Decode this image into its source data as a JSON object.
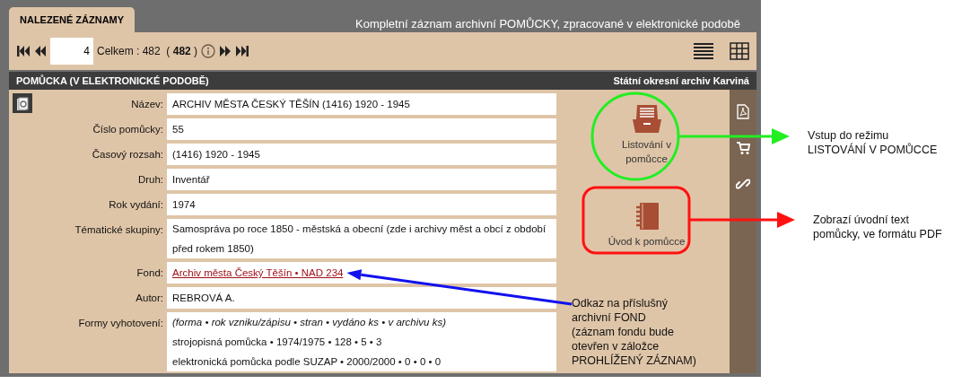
{
  "tab": {
    "label": "NALEZENÉ ZÁZNAMY",
    "selected": true
  },
  "heading": "Kompletní záznam archivní POMŮCKY, zpracované v elektronické podobě",
  "pager": {
    "page": "4",
    "total": "Celkem : 482  ( **482** )"
  },
  "section": {
    "title": "POMŮCKA (V ELEKTRONICKÉ PODOBĚ)",
    "archive": "Státní okresní archiv Karviná"
  },
  "fields": [
    {
      "label": "Název:",
      "kind": "text",
      "lines": [
        "ARCHIV MĚSTA ČESKÝ TĚŠÍN (1416) 1920 - 1945"
      ]
    },
    {
      "label": "Číslo pomůcky:",
      "kind": "text",
      "lines": [
        "55"
      ]
    },
    {
      "label": "Časový rozsah:",
      "kind": "text",
      "lines": [
        "(1416) 1920 - 1945"
      ]
    },
    {
      "label": "Druh:",
      "kind": "text",
      "lines": [
        "Inventář"
      ]
    },
    {
      "label": "Rok vydání:",
      "kind": "text",
      "lines": [
        "1974"
      ]
    },
    {
      "label": "Tématické skupiny:",
      "kind": "text",
      "lines": [
        "Samospráva po roce 1850 - městská a obecní (zde i archivy měst a obcí z období před rokem 1850)"
      ]
    },
    {
      "label": "Fond:",
      "kind": "link",
      "lines": [
        "Archiv města Český Těšín • NAD 234"
      ]
    },
    {
      "label": "Autor:",
      "kind": "text",
      "lines": [
        "REBROVÁ A."
      ]
    },
    {
      "label": "Formy vyhotovení:",
      "kind": "list",
      "legend": "(forma • rok vzniku/zápisu • stran • vydáno ks • v archivu ks)",
      "lines": [
        "strojopisná pomůcka • 1974/1975 • 128 • 5 • 3",
        "elektronická pomůcka podle SUZAP • 2000/2000 • 0 • 0 • 0"
      ]
    }
  ],
  "actions": [
    {
      "label": "Listování v pomůcce",
      "kind": "drawer"
    },
    {
      "label": "Úvod k pomůcce",
      "kind": "notebook"
    }
  ],
  "annotations": [
    {
      "text": "Vstup do režimu\nLISTOVÁNÍ V POMŮCCE",
      "color": "#22ee22"
    },
    {
      "text": "Zobrazí úvodní text\npomůcky, ve formátu PDF",
      "color": "#ff1111"
    },
    {
      "text": "Odkaz na příslušný\narchivní FOND\n(záznam fondu bude\notevřen v záložce\nPROHLÍŽENÝ ZÁZNAM)",
      "color": "#1111ee"
    }
  ]
}
